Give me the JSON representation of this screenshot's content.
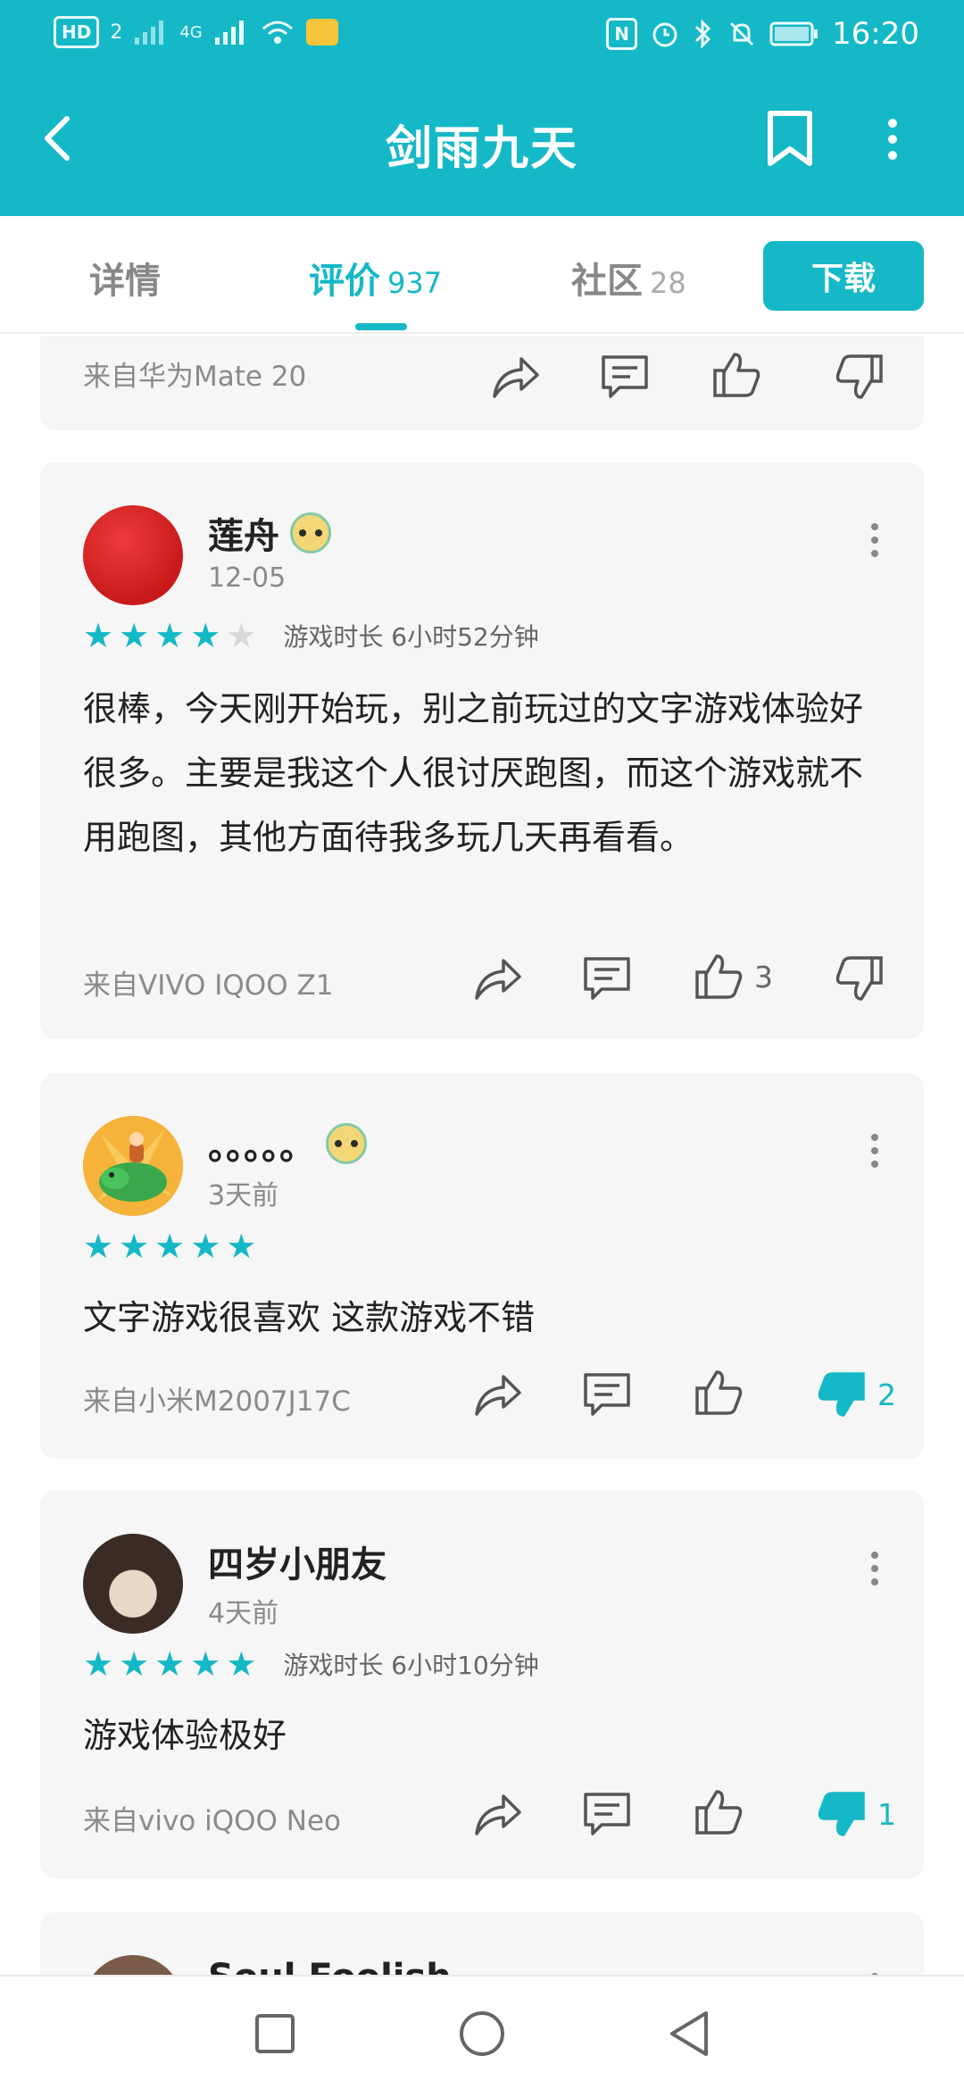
{
  "status_bar": {
    "hd": "HD",
    "sim": "2",
    "network": "4G",
    "time": "16:20",
    "nfc": "N"
  },
  "header": {
    "title": "剑雨九天"
  },
  "tabs": [
    {
      "label": "详情",
      "count": ""
    },
    {
      "label": "评价",
      "count": "937"
    },
    {
      "label": "社区",
      "count": "28"
    }
  ],
  "download_label": "下载",
  "accent_color": "#15b8c6",
  "partial_review": {
    "device": "来自华为Mate 20"
  },
  "reviews": [
    {
      "user": "莲舟",
      "date": "12-05",
      "rating": 4,
      "playtime": "游戏时长 6小时52分钟",
      "text": "很棒，今天刚开始玩，别之前玩过的文字游戏体验好很多。主要是我这个人很讨厌跑图，而这个游戏就不用跑图，其他方面待我多玩几天再看看。",
      "device": "来自VIVO IQOO Z1",
      "likes": "3",
      "dislikes": ""
    },
    {
      "user": "。。。。。",
      "date": "3天前",
      "rating": 5,
      "playtime": "",
      "text": "文字游戏很喜欢 这款游戏不错",
      "device": "来自小米M2007J17C",
      "likes": "",
      "dislikes": "2"
    },
    {
      "user": "四岁小朋友",
      "date": "4天前",
      "rating": 5,
      "playtime": "游戏时长 6小时10分钟",
      "text": "游戏体验极好",
      "device": "来自vivo iQOO Neo",
      "likes": "",
      "dislikes": "1"
    }
  ],
  "partial_next_user": "Soul  Foolish"
}
